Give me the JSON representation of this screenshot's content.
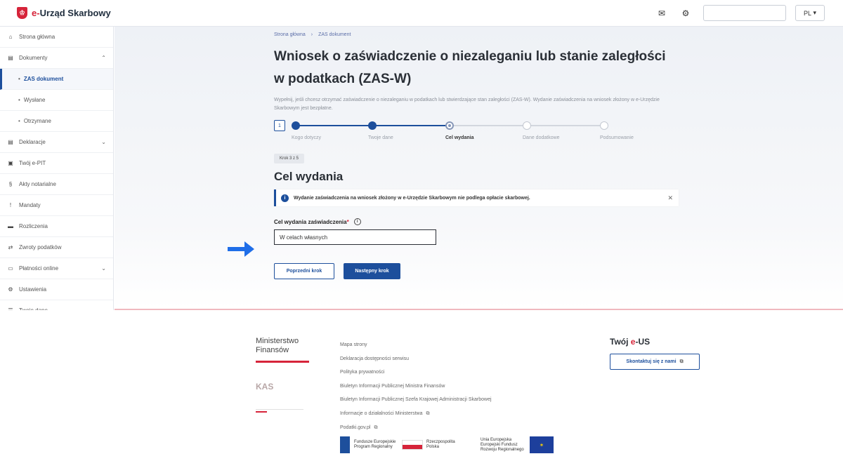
{
  "header": {
    "logo_prefix": "e-",
    "logo_text": "Urząd Skarbowy",
    "search_value": "",
    "language": "PL"
  },
  "sidebar": {
    "items": [
      {
        "label": "Strona główna",
        "icon": "home-icon"
      },
      {
        "label": "Dokumenty",
        "icon": "document-icon"
      },
      {
        "label": "ZAS dokument"
      },
      {
        "label": "Wysłane"
      },
      {
        "label": "Otrzymane"
      },
      {
        "label": "Deklaracje",
        "icon": "declaration-icon"
      },
      {
        "label": "Twój e-PIT",
        "icon": "pit-icon"
      },
      {
        "label": "Akty notarialne",
        "icon": "notary-icon"
      },
      {
        "label": "Mandaty",
        "icon": "ticket-icon"
      },
      {
        "label": "Rozliczenia",
        "icon": "settlement-icon"
      },
      {
        "label": "Zwroty podatków",
        "icon": "refund-icon"
      },
      {
        "label": "Płatności online",
        "icon": "payment-icon"
      },
      {
        "label": "Ustawienia",
        "icon": "settings-icon"
      },
      {
        "label": "Twoje dane",
        "icon": "user-data-icon"
      }
    ]
  },
  "main": {
    "breadcrumb": [
      "Strona główna",
      "ZAS dokument"
    ],
    "title": "Wniosek o zaświadczenie o niezaleganiu lub stanie zaległości w podatkach (ZAS-W)",
    "intro": "Wypełnij, jeśli chcesz otrzymać zaświadczenie o niezaleganiu w podatkach lub stwierdzające stan zaległości (ZAS-W). Wydanie zaświadczenia na wniosek złożony w e-Urzędzie Skarbowym jest bezpłatne.",
    "step_number": "1",
    "steps": [
      {
        "label": "Kogo dotyczy",
        "status": "done"
      },
      {
        "label": "Twoje dane",
        "status": "done"
      },
      {
        "label": "Cel wydania",
        "status": "current"
      },
      {
        "label": "Dane dodatkowe",
        "status": "todo"
      },
      {
        "label": "Podsumowanie",
        "status": "todo"
      }
    ],
    "step_badge": "Krok 3 z 5",
    "section_title": "Cel wydania",
    "alert_text": "Wydanie zaświadczenia na wniosek złożony w e-Urzędzie Skarbowym nie podlega opłacie skarbowej.",
    "field_label": "Cel wydania zaświadczenia",
    "field_required": "*",
    "field_value": "W celach własnych",
    "prev_button": "Poprzedni krok",
    "next_button": "Następny krok"
  },
  "footer": {
    "ministry_name": "Ministerstwo Finansów",
    "kas_logo": "KAS",
    "links": [
      "Mapa strony",
      "Deklaracja dostępności serwisu",
      "Polityka prywatności",
      "Biuletyn Informacji Publicznej Ministra Finansów",
      "Biuletyn Informacji Publicznej Szefa Krajowej Administracji Skarbowej",
      "Informacje o działalności Ministerstwa",
      "Podatki.gov.pl"
    ],
    "us_title_prefix": "Twój ",
    "us_title_e": "e",
    "us_title_suffix": "-US",
    "contact_button": "Skontaktuj się z nami",
    "eu_fe": "Fundusze Europejskie Program Regionalny",
    "eu_pl": "Rzeczpospolita Polska",
    "eu_ue": "Unia Europejska Europejski Fundusz Rozwoju Regionalnego"
  },
  "colors": {
    "primary": "#1d4f9c",
    "brand_red": "#d6243a"
  }
}
